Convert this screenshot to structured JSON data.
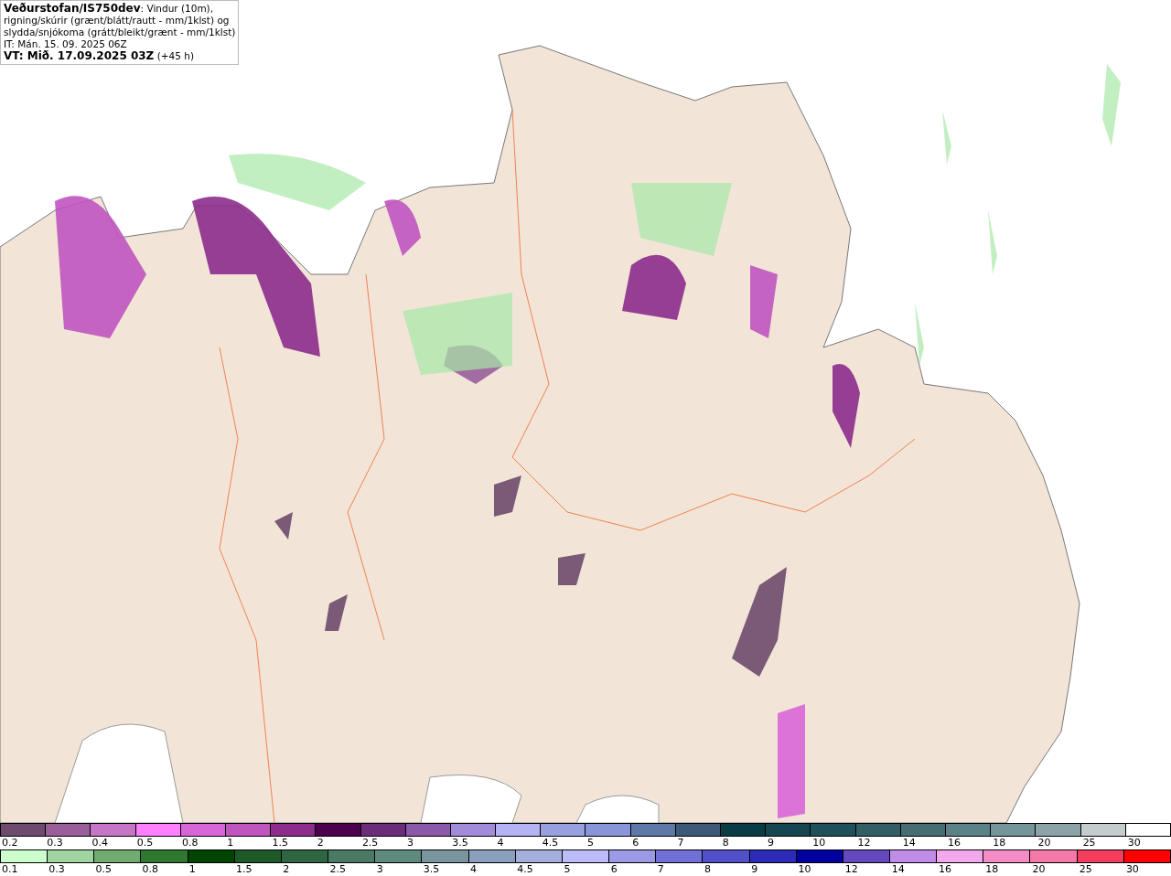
{
  "legend": {
    "lines": [
      "**Veðurstofan/IS750dev**: Vindur (10m),",
      "rigning/skúrir (grænt/blátt/rautt - mm/1klst) og",
      "slydda/snjókoma (grátt/bleikt/grænt - mm/1klst)",
      "IT: Mán. 15. 09. 2025 06Z",
      "**VT: Mið. 17.09.2025 03Z** (+45 h)"
    ]
  },
  "colorbars": [
    {
      "swatches": [
        {
          "label": "0.2",
          "color": "#6e4a6e"
        },
        {
          "label": "0.3",
          "color": "#9a5f9a"
        },
        {
          "label": "0.4",
          "color": "#c775c7"
        },
        {
          "label": "0.5",
          "color": "#ff80ff"
        },
        {
          "label": "0.8",
          "color": "#d966d9"
        },
        {
          "label": "1",
          "color": "#c055c0"
        },
        {
          "label": "1.5",
          "color": "#8c2d8c"
        },
        {
          "label": "2",
          "color": "#4d004d"
        },
        {
          "label": "2.5",
          "color": "#6b2d7a"
        },
        {
          "label": "3",
          "color": "#8a5aa8"
        },
        {
          "label": "3.5",
          "color": "#a08cd8"
        },
        {
          "label": "4",
          "color": "#b4b4f5"
        },
        {
          "label": "4.5",
          "color": "#98a0e0"
        },
        {
          "label": "5",
          "color": "#8a94d8"
        },
        {
          "label": "6",
          "color": "#5e78a8"
        },
        {
          "label": "7",
          "color": "#3c5a78"
        },
        {
          "label": "8",
          "color": "#0a3c46"
        },
        {
          "label": "9",
          "color": "#164650"
        },
        {
          "label": "10",
          "color": "#1e505a"
        },
        {
          "label": "12",
          "color": "#325f66"
        },
        {
          "label": "14",
          "color": "#466e72"
        },
        {
          "label": "16",
          "color": "#5a8288"
        },
        {
          "label": "18",
          "color": "#74969a"
        },
        {
          "label": "20",
          "color": "#8ca4a8"
        },
        {
          "label": "25",
          "color": "#c4ccce"
        },
        {
          "label": "30",
          "color": "#ffffff"
        }
      ]
    },
    {
      "swatches": [
        {
          "label": "0.1",
          "color": "#ccffcc"
        },
        {
          "label": "0.3",
          "color": "#a0d4a0"
        },
        {
          "label": "0.5",
          "color": "#70ac70"
        },
        {
          "label": "0.8",
          "color": "#307830"
        },
        {
          "label": "1",
          "color": "#004400"
        },
        {
          "label": "1.5",
          "color": "#1e5a28"
        },
        {
          "label": "2",
          "color": "#2d6640"
        },
        {
          "label": "2.5",
          "color": "#4a7a64"
        },
        {
          "label": "3",
          "color": "#5e8a80"
        },
        {
          "label": "3.5",
          "color": "#7a94a0"
        },
        {
          "label": "4",
          "color": "#8aa0bc"
        },
        {
          "label": "4.5",
          "color": "#a4b0dc"
        },
        {
          "label": "5",
          "color": "#bcbcf8"
        },
        {
          "label": "6",
          "color": "#9a9ae6"
        },
        {
          "label": "7",
          "color": "#7070d8"
        },
        {
          "label": "8",
          "color": "#5050c8"
        },
        {
          "label": "9",
          "color": "#2c2cb8"
        },
        {
          "label": "10",
          "color": "#0000a0"
        },
        {
          "label": "12",
          "color": "#6448c0"
        },
        {
          "label": "14",
          "color": "#c08ce8"
        },
        {
          "label": "16",
          "color": "#f4a8ec"
        },
        {
          "label": "18",
          "color": "#f48cc8"
        },
        {
          "label": "20",
          "color": "#f478a8"
        },
        {
          "label": "25",
          "color": "#f43c5c"
        },
        {
          "label": "30",
          "color": "#ff0000"
        }
      ]
    }
  ]
}
